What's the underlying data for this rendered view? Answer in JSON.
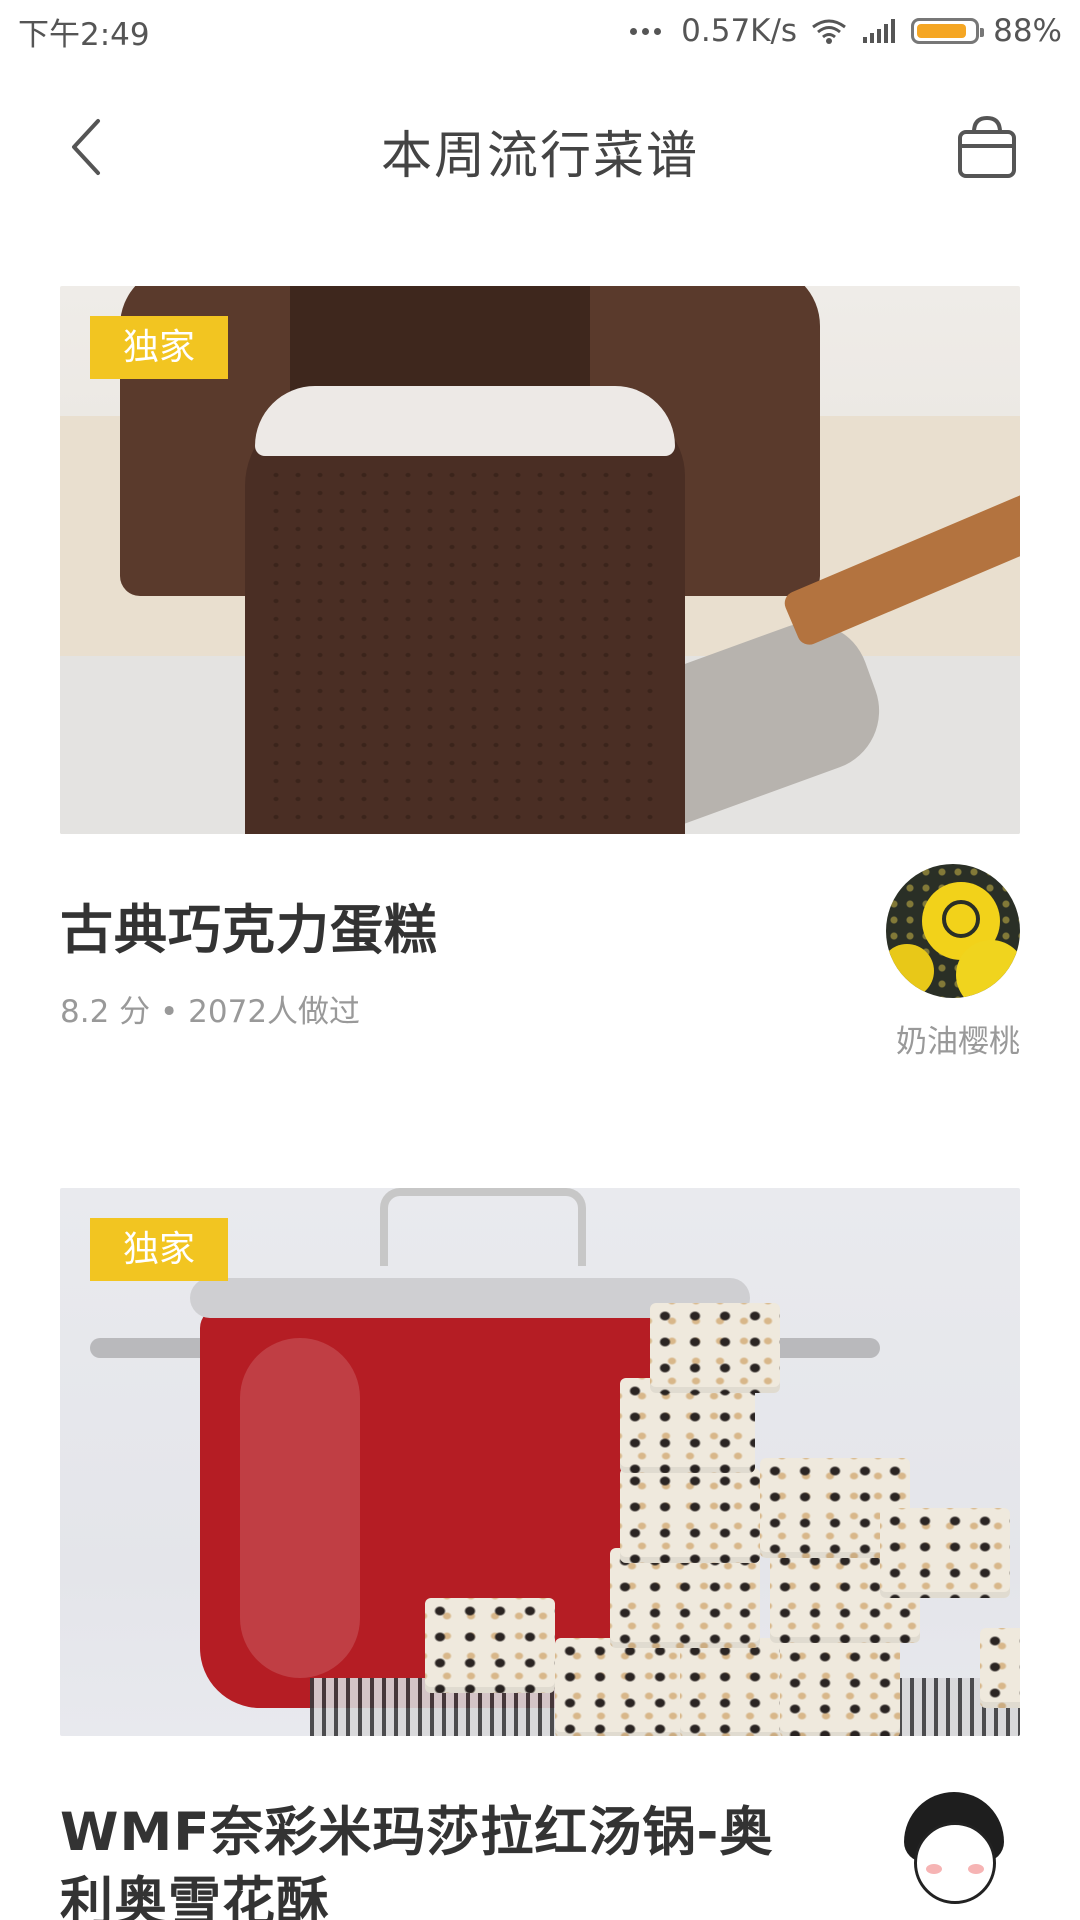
{
  "status_bar": {
    "time": "下午2:49",
    "network_speed": "0.57K/s",
    "battery_percent": "88%",
    "battery_level": 0.88,
    "icons": [
      "more-dots-icon",
      "wifi-icon",
      "signal-icon",
      "battery-icon"
    ]
  },
  "header": {
    "title": "本周流行菜谱",
    "back_icon": "chevron-left-icon",
    "bag_icon": "shopping-bag-icon"
  },
  "recipes": [
    {
      "badge": "独家",
      "title": "古典巧克力蛋糕",
      "meta": "8.2 分 • 2072人做过",
      "author": "奶油樱桃"
    },
    {
      "badge": "独家",
      "title": "WMF奈彩米玛莎拉红汤锅-奥利奥雪花酥",
      "meta": "",
      "author": ""
    }
  ],
  "colors": {
    "badge_bg": "#f2c521",
    "title_text": "#333333",
    "muted_text": "#999999",
    "battery_fill": "#f5a623"
  }
}
